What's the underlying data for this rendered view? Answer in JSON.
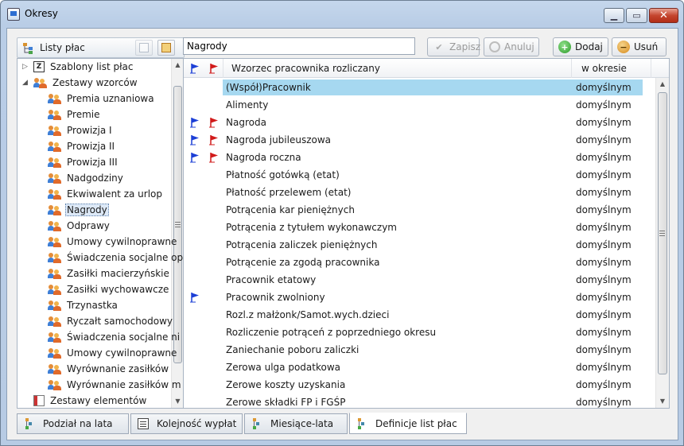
{
  "window": {
    "title": "Okresy"
  },
  "left": {
    "title": "Listy płac",
    "tree": [
      {
        "label": "Szablony list płac",
        "icon": "z-template-icon",
        "level": 0,
        "expander": "collapsed"
      },
      {
        "label": "Zestawy wzorców",
        "icon": "people-icon",
        "level": 0,
        "expander": "expanded"
      },
      {
        "label": "Premia uznaniowa",
        "icon": "people-icon",
        "level": 1
      },
      {
        "label": "Premie",
        "icon": "people-icon",
        "level": 1
      },
      {
        "label": "Prowizja I",
        "icon": "people-icon",
        "level": 1
      },
      {
        "label": "Prowizja II",
        "icon": "people-icon",
        "level": 1
      },
      {
        "label": "Prowizja III",
        "icon": "people-icon",
        "level": 1
      },
      {
        "label": "Nadgodziny",
        "icon": "people-icon",
        "level": 1
      },
      {
        "label": "Ekwiwalent za urlop",
        "icon": "people-icon",
        "level": 1
      },
      {
        "label": "Nagrody",
        "icon": "people-icon",
        "level": 1,
        "selected": true
      },
      {
        "label": "Odprawy",
        "icon": "people-icon",
        "level": 1
      },
      {
        "label": "Umowy cywilnoprawne",
        "icon": "people-icon",
        "level": 1
      },
      {
        "label": "Świadczenia socjalne op",
        "icon": "people-icon",
        "level": 1
      },
      {
        "label": "Zasiłki macierzyńskie",
        "icon": "people-icon",
        "level": 1
      },
      {
        "label": "Zasiłki wychowawcze",
        "icon": "people-icon",
        "level": 1
      },
      {
        "label": "Trzynastka",
        "icon": "people-icon",
        "level": 1
      },
      {
        "label": "Ryczałt samochodowy",
        "icon": "people-icon",
        "level": 1
      },
      {
        "label": "Świadczenia socjalne ni",
        "icon": "people-icon",
        "level": 1
      },
      {
        "label": "Umowy cywilnoprawne",
        "icon": "people-icon",
        "level": 1
      },
      {
        "label": "Wyrównanie zasiłków",
        "icon": "people-icon",
        "level": 1
      },
      {
        "label": "Wyrównanie zasiłków m",
        "icon": "people-icon",
        "level": 1
      },
      {
        "label": "Zestawy elementów",
        "icon": "grid-icon",
        "level": 0,
        "expander": "none"
      }
    ]
  },
  "toolbar": {
    "search_value": "Nagrody",
    "zapisz": "Zapisz",
    "anuluj": "Anuluj",
    "dodaj": "Dodaj",
    "usun": "Usuń"
  },
  "grid": {
    "columns": {
      "name": "Wzorzec pracownika rozliczany",
      "period": "w okresie"
    },
    "rows": [
      {
        "name": "(Współ)Pracownik",
        "period": "domyślnym",
        "blue": false,
        "red": false,
        "selected": true
      },
      {
        "name": "Alimenty",
        "period": "domyślnym",
        "blue": false,
        "red": false
      },
      {
        "name": "Nagroda",
        "period": "domyślnym",
        "blue": true,
        "red": true
      },
      {
        "name": "Nagroda jubileuszowa",
        "period": "domyślnym",
        "blue": true,
        "red": true
      },
      {
        "name": "Nagroda roczna",
        "period": "domyślnym",
        "blue": true,
        "red": true
      },
      {
        "name": "Płatność gotówką (etat)",
        "period": "domyślnym",
        "blue": false,
        "red": false
      },
      {
        "name": "Płatność przelewem (etat)",
        "period": "domyślnym",
        "blue": false,
        "red": false
      },
      {
        "name": "Potrącenia kar pieniężnych",
        "period": "domyślnym",
        "blue": false,
        "red": false
      },
      {
        "name": "Potrącenia z tytułem wykonawczym",
        "period": "domyślnym",
        "blue": false,
        "red": false
      },
      {
        "name": "Potrącenia zaliczek pieniężnych",
        "period": "domyślnym",
        "blue": false,
        "red": false
      },
      {
        "name": "Potrącenie za zgodą pracownika",
        "period": "domyślnym",
        "blue": false,
        "red": false
      },
      {
        "name": "Pracownik etatowy",
        "period": "domyślnym",
        "blue": false,
        "red": false
      },
      {
        "name": "Pracownik zwolniony",
        "period": "domyślnym",
        "blue": true,
        "red": false
      },
      {
        "name": "Rozl.z małżonk/Samot.wych.dzieci",
        "period": "domyślnym",
        "blue": false,
        "red": false
      },
      {
        "name": "Rozliczenie potrąceń z poprzedniego okresu",
        "period": "domyślnym",
        "blue": false,
        "red": false
      },
      {
        "name": "Zaniechanie poboru zaliczki",
        "period": "domyślnym",
        "blue": false,
        "red": false
      },
      {
        "name": "Zerowa ulga podatkowa",
        "period": "domyślnym",
        "blue": false,
        "red": false
      },
      {
        "name": "Zerowe koszty uzyskania",
        "period": "domyślnym",
        "blue": false,
        "red": false
      },
      {
        "name": "Zerowe składki FP i FGŚP",
        "period": "domyślnym",
        "blue": false,
        "red": false
      }
    ]
  },
  "tabs": [
    {
      "label": "Podział na lata",
      "icon": "tree-icon"
    },
    {
      "label": "Kolejność wypłat",
      "icon": "document-icon"
    },
    {
      "label": "Miesiące-lata",
      "icon": "tree-icon"
    },
    {
      "label": "Definicje list płac",
      "icon": "tree-icon",
      "active": true
    }
  ],
  "colors": {
    "flag_blue": "#1c3fd6",
    "flag_red": "#d11a1a",
    "selection": "#a6d8f0"
  }
}
